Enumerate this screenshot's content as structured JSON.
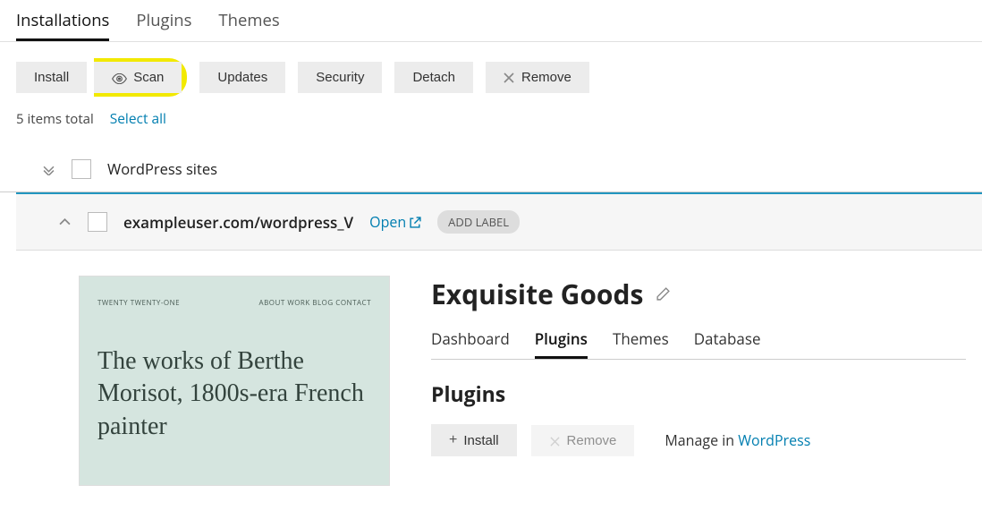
{
  "tabs": {
    "installations": "Installations",
    "plugins": "Plugins",
    "themes": "Themes"
  },
  "toolbar": {
    "install": "Install",
    "scan": "Scan",
    "updates": "Updates",
    "security": "Security",
    "detach": "Detach",
    "remove": "Remove"
  },
  "meta": {
    "count_text": "5 items total",
    "select_all": "Select all"
  },
  "group": {
    "title": "WordPress sites"
  },
  "site": {
    "path": "exampleuser.com/wordpress_V",
    "open": "Open",
    "add_label": "ADD LABEL",
    "title": "Exquisite Goods",
    "thumb_brand": "TWENTY TWENTY-ONE",
    "thumb_menu": "ABOUT   WORK   BLOG   CONTACT",
    "thumb_headline": "The works of Berthe Morisot, 1800s-era French painter"
  },
  "subtabs": {
    "dashboard": "Dashboard",
    "plugins": "Plugins",
    "themes": "Themes",
    "database": "Database"
  },
  "plugins_section": {
    "title": "Plugins",
    "install": "Install",
    "remove": "Remove",
    "manage_prefix": "Manage in ",
    "manage_link": "WordPress"
  }
}
